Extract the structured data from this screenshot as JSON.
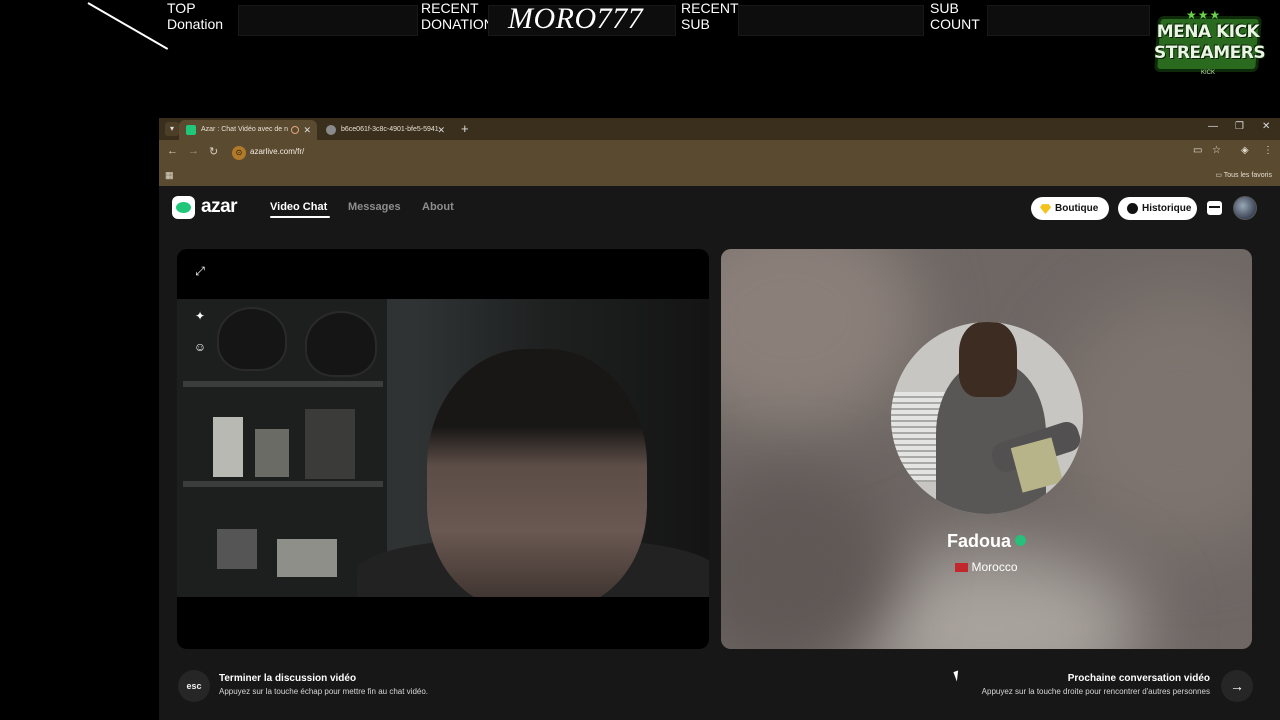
{
  "overlay": {
    "top_donation_label": "TOP\nDonation",
    "recent_donation_label": "RECENT\nDONATION",
    "recent_donation_name": "MORO777",
    "recent_sub_label": "RECENT\nSUB",
    "sub_count_label": "SUB\nCOUNT",
    "badge_line1": "MENA KICK",
    "badge_line2": "STREAMERS",
    "badge_small": "KICK"
  },
  "browser": {
    "tabs": [
      {
        "title": "Azar : Chat Vidéo avec de n",
        "active": true
      },
      {
        "title": "b6ce061f-3c8c-4901-bfe5-5941",
        "active": false
      }
    ],
    "url": "azarlive.com/fr/",
    "bookmarks_folder": "Tous les favoris"
  },
  "azar": {
    "logo_text": "azar",
    "nav": [
      "Video Chat",
      "Messages",
      "About"
    ],
    "boutique_label": "Boutique",
    "historique_label": "Historique",
    "peer": {
      "name": "Fadoua",
      "country": "Morocco"
    },
    "end_chat": {
      "key_label": "esc",
      "title": "Terminer la discussion vidéo",
      "subtitle": "Appuyez sur la touche échap pour mettre fin au chat vidéo."
    },
    "next_chat": {
      "title": "Prochaine conversation vidéo",
      "subtitle": "Appuyez sur la touche droite pour rencontrer d'autres personnes",
      "key_label": "→"
    }
  },
  "colors": {
    "azar_green": "#20c77a",
    "tab_bar": "#3a2f1d",
    "toolbar": "#5a4a30",
    "page_bg": "#171717"
  }
}
